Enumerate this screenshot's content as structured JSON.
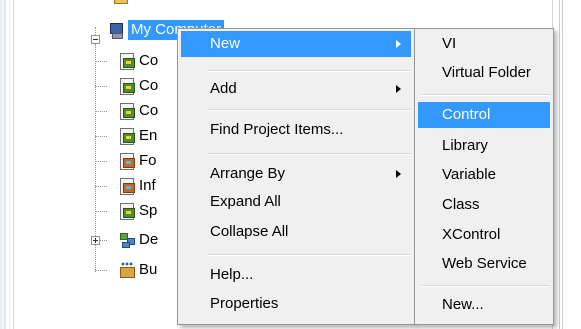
{
  "tree": {
    "root_label": "My Computer",
    "children": [
      {
        "label": "Co",
        "icon": "vi-icon"
      },
      {
        "label": "Co",
        "icon": "vi-icon"
      },
      {
        "label": "Co",
        "icon": "vi-icon"
      },
      {
        "label": "En",
        "icon": "vi-icon"
      },
      {
        "label": "Fo",
        "icon": "vi-variant-icon"
      },
      {
        "label": "Inf",
        "icon": "vi-variant-icon"
      },
      {
        "label": "Sp",
        "icon": "vi-icon"
      },
      {
        "label": "De",
        "icon": "dependencies-icon"
      },
      {
        "label": "Bu",
        "icon": "build-spec-icon"
      }
    ]
  },
  "context_menu": {
    "items": [
      {
        "label": "New",
        "has_submenu": true,
        "highlighted": true
      },
      {
        "label": "Add",
        "has_submenu": true
      },
      {
        "label": "Find Project Items..."
      },
      {
        "label": "Arrange By",
        "has_submenu": true
      },
      {
        "label": "Expand All"
      },
      {
        "label": "Collapse All"
      },
      {
        "label": "Help..."
      },
      {
        "label": "Properties"
      }
    ]
  },
  "new_submenu": {
    "items": [
      {
        "label": "VI"
      },
      {
        "label": "Virtual Folder"
      },
      {
        "label": "Control",
        "highlighted": true
      },
      {
        "label": "Library"
      },
      {
        "label": "Variable"
      },
      {
        "label": "Class"
      },
      {
        "label": "XControl"
      },
      {
        "label": "Web Service"
      },
      {
        "label": "New..."
      }
    ]
  },
  "colors": {
    "highlight": "#3399ff",
    "menu_bg": "#f0f0f0"
  }
}
